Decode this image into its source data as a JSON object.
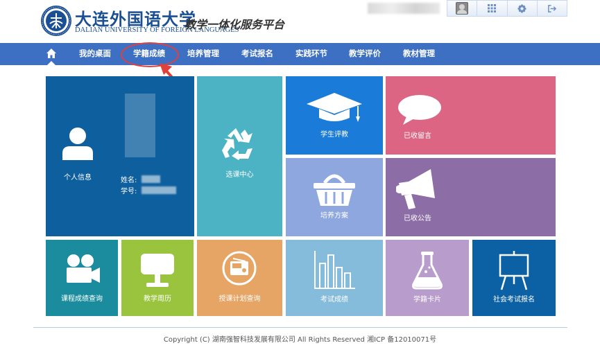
{
  "header": {
    "logo_cn": "大连外国语大学",
    "logo_en": "DALIAN UNIVERSITY OF FOREIGN LANGUAGES",
    "platform_title": "教学一体化服务平台",
    "toolbar": [
      "avatar-icon",
      "grid-icon",
      "gear-icon",
      "logout-icon"
    ]
  },
  "nav": {
    "items": [
      "我的桌面",
      "学籍成绩",
      "培养管理",
      "考试报名",
      "实践环节",
      "教学评价",
      "教材管理"
    ]
  },
  "tiles": {
    "personal": {
      "label": "个人信息",
      "name_label": "姓名:",
      "id_label": "学号:"
    },
    "course_select": {
      "label": "选课中心"
    },
    "student_eval": {
      "label": "学生评教"
    },
    "messages": {
      "label": "已收留言"
    },
    "training_plan": {
      "label": "培养方案"
    },
    "announcements": {
      "label": "已收公告"
    },
    "course_grades": {
      "label": "课程成绩查询"
    },
    "teaching_calendar": {
      "label": "教学周历"
    },
    "course_plan": {
      "label": "授课计划查询"
    },
    "exam_grades": {
      "label": "考试成绩"
    },
    "student_card": {
      "label": "学籍卡片"
    },
    "social_exam": {
      "label": "社会考试报名"
    }
  },
  "colors": {
    "nav": "#3d6fc3",
    "personal": "#0e5f9e",
    "course_select": "#4bb3c4",
    "student_eval": "#1b7bd8",
    "messages": "#db6583",
    "training_plan": "#8fa7df",
    "announcements": "#8c6da6",
    "course_grades": "#1a8c9e",
    "teaching_calendar": "#9ac43d",
    "course_plan": "#e6a565",
    "exam_grades": "#85bbdb",
    "student_card": "#b89ccc",
    "social_exam": "#0b61a3",
    "annotation": "#e0413d"
  },
  "footer": {
    "copyright": "Copyright (C) 湖南强智科技发展有限公司 All Rights Reserved 湘ICP 备12010071号"
  }
}
